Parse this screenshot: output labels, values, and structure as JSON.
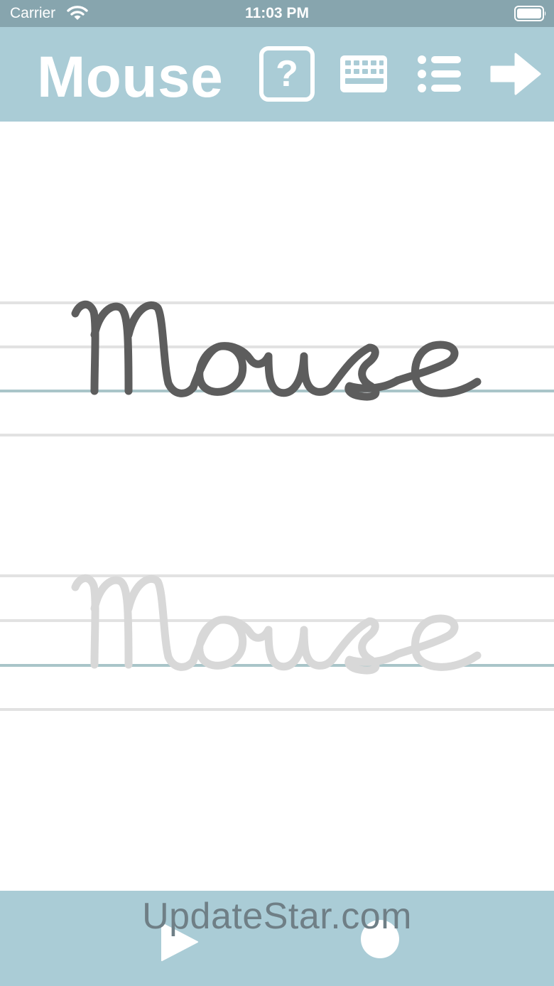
{
  "status_bar": {
    "carrier": "Carrier",
    "time": "11:03 PM",
    "wifi_icon": "wifi-icon",
    "battery_icon": "battery-icon"
  },
  "toolbar": {
    "title": "Mouse",
    "icons": [
      "help-icon",
      "keyboard-icon",
      "list-icon",
      "arrow-right-icon"
    ],
    "background": "#aaccd6"
  },
  "writing": {
    "model_word": "Mouse",
    "trace_word": "Mouse",
    "model_color": "#5d5d5d",
    "trace_color": "#d8d8d8",
    "guide_line_color": "#e2e2e2",
    "baseline_color": "#a9c5c9"
  },
  "bottom_bar": {
    "play_icon": "play-icon",
    "record_icon": "record-icon",
    "watermark": "UpdateStar.com"
  }
}
